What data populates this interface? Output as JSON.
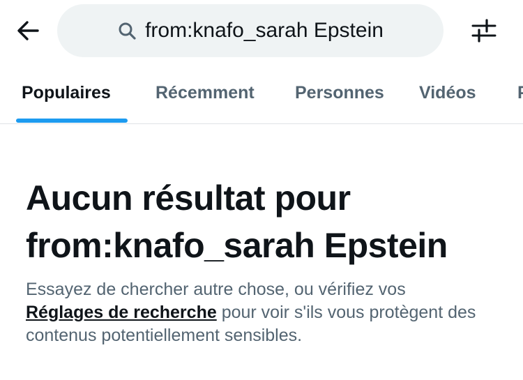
{
  "header": {
    "search_query": "from:knafo_sarah Epstein",
    "back_icon": "arrow-left-icon",
    "search_icon": "search-icon",
    "filter_icon": "sliders-icon"
  },
  "tabs": [
    {
      "label": "Populaires",
      "active": true
    },
    {
      "label": "Récemment",
      "active": false
    },
    {
      "label": "Personnes",
      "active": false
    },
    {
      "label": "Vidéos",
      "active": false
    },
    {
      "label": "P",
      "active": false
    }
  ],
  "empty_state": {
    "title_line1": "Aucun résultat pour",
    "title_line2": "from:knafo_sarah Epstein",
    "desc_before": "Essayez de chercher autre chose, ou vérifiez vos",
    "desc_link": "Réglages de recherche",
    "desc_after": "pour voir s'ils vous protègent des contenus potentiellement sensibles."
  },
  "colors": {
    "accent": "#1d9bf0",
    "text_primary": "#0f1419",
    "text_secondary": "#536471",
    "search_background": "#eff3f4"
  }
}
